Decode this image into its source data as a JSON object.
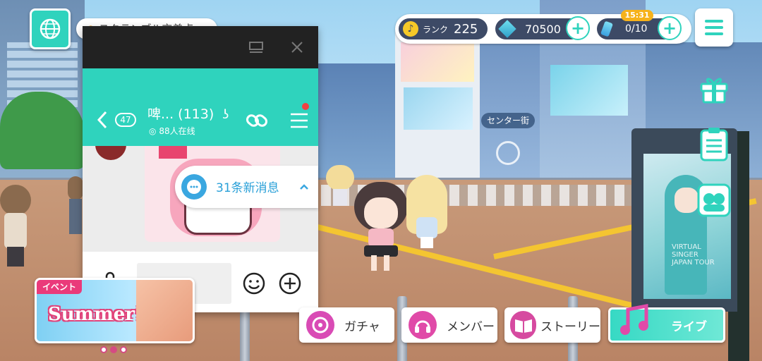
{
  "topbar": {
    "location": "スクランブル交差点",
    "rank_label": "ランク",
    "rank_value": "225",
    "crystals": "70500",
    "stamina": "0/10",
    "timer": "15:31"
  },
  "map": {
    "marker_label": "センター街"
  },
  "signboard": {
    "text_line1": "VIRTUAL",
    "text_line2": "SINGER",
    "text_line3": "JAPAN TOUR"
  },
  "chat": {
    "back_badge": "47",
    "group_title": "啤... (113)",
    "online_status": "88人在线",
    "new_messages": "31条新消息"
  },
  "event": {
    "tag": "イベント",
    "logo": "Summer!"
  },
  "nav": {
    "gacha": "ガチャ",
    "member": "メンバー",
    "story": "ストーリー",
    "live": "ライブ"
  },
  "colors": {
    "accent": "#2fd3bd",
    "chat_header": "#2fd3bd",
    "event_pink": "#ea3a7a"
  }
}
